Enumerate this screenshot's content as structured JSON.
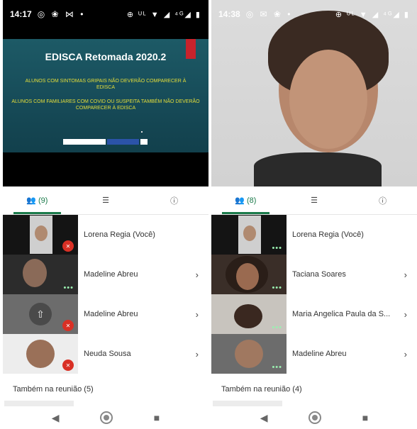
{
  "left": {
    "status": {
      "time": "14:17",
      "left_icons": "◎ ❀ ⋈ •",
      "right_icons": "⊕ ᵁᴸ ▼ ◢ ⁴ᴳ◢ ▮"
    },
    "slide": {
      "title": "EDISCA Retomada 2020.2",
      "line1": "ALUNOS COM SINTOMAS GRIPAIS NÃO DEVERÃO COMPARECER À EDISCA",
      "line2": "ALUNOS COM FAMILIARES COM COVID OU SUSPEITA TAMBÉM NÃO DEVERÃO COMPARECER À EDISCA"
    },
    "tabs": {
      "people_count": "(9)"
    },
    "participants": [
      {
        "name": "Lorena Regia (Você)",
        "has_chevron": false
      },
      {
        "name": "Madeline Abreu",
        "has_chevron": true
      },
      {
        "name": "Madeline Abreu",
        "has_chevron": true
      },
      {
        "name": "Neuda Sousa",
        "has_chevron": true
      }
    ],
    "also_in_meeting": "Também na reunião (5)"
  },
  "right": {
    "status": {
      "time": "14:38",
      "left_icons": "◎ ✉ ❀ •",
      "right_icons": "⊕ ᵁᴸ ▼ ◢ ⁴ᴳ◢ ▮"
    },
    "tabs": {
      "people_count": "(8)"
    },
    "participants": [
      {
        "name": "Lorena Regia (Você)",
        "has_chevron": false
      },
      {
        "name": "Taciana Soares",
        "has_chevron": true
      },
      {
        "name": "Maria Angelica Paula da S...",
        "has_chevron": true
      },
      {
        "name": "Madeline Abreu",
        "has_chevron": true
      }
    ],
    "also_in_meeting": "Também na reunião (4)"
  },
  "glyphs": {
    "chevron": "›",
    "mute": "✕",
    "dots": "•••",
    "back": "◀",
    "recent": "■",
    "present": "⇧",
    "chat": "☰",
    "info": "ⓘ",
    "people": "👥"
  },
  "colors": {
    "accent": "#1a7a4a",
    "mute_red": "#d93025",
    "slide_teal": "#1d5a66",
    "slide_yellow": "#e6de3a"
  }
}
